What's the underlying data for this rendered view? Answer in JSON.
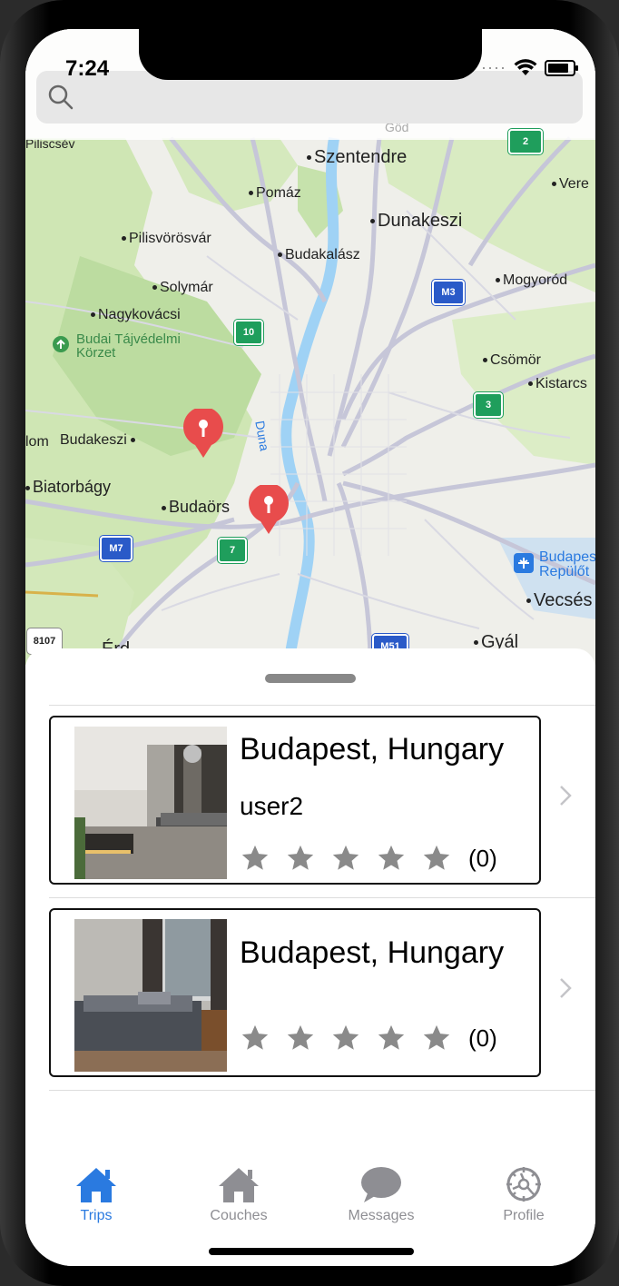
{
  "status": {
    "time": "7:24"
  },
  "search": {
    "placeholder": ""
  },
  "map": {
    "places": [
      {
        "label": "Piliscsév"
      },
      {
        "label": "Szentendre"
      },
      {
        "label": "Pomáz"
      },
      {
        "label": "Vere"
      },
      {
        "label": "Dunakeszi"
      },
      {
        "label": "Pilisvörösvár"
      },
      {
        "label": "Budakalász"
      },
      {
        "label": "Mogyoród"
      },
      {
        "label": "Solymár"
      },
      {
        "label": "Nagykovácsi"
      },
      {
        "label": "Budai Tájvédelmi Körzet"
      },
      {
        "label": "Csömör"
      },
      {
        "label": "Kistarcs"
      },
      {
        "label": "Duna"
      },
      {
        "label": "lom"
      },
      {
        "label": "Budakeszi"
      },
      {
        "label": "Biatorbágy"
      },
      {
        "label": "Budaörs"
      },
      {
        "label": "Budapest Repülőt"
      },
      {
        "label": "Vecsés"
      },
      {
        "label": "Érd"
      },
      {
        "label": "Gyál"
      },
      {
        "label": "Göd"
      }
    ],
    "shields": [
      "10",
      "M3",
      "3",
      "M7",
      "7",
      "8107",
      "M51",
      "2"
    ]
  },
  "trips": [
    {
      "title": "Budapest, Hungary",
      "user": "user2",
      "rating_count": "(0)",
      "stars": 0
    },
    {
      "title": "Budapest, Hungary",
      "user": "",
      "rating_count": "(0)",
      "stars": 0
    }
  ],
  "tabs": [
    {
      "label": "Trips",
      "icon": "house-icon",
      "active": true
    },
    {
      "label": "Couches",
      "icon": "house-icon",
      "active": false
    },
    {
      "label": "Messages",
      "icon": "chat-bubble-icon",
      "active": false
    },
    {
      "label": "Profile",
      "icon": "gear-icon",
      "active": false
    }
  ],
  "colors": {
    "accent": "#2a7ae0",
    "inactive": "#8e8e93",
    "pin": "#e84c4c"
  }
}
